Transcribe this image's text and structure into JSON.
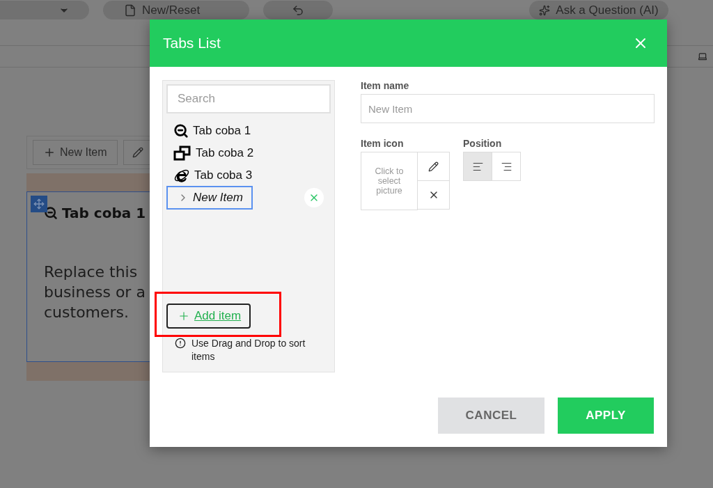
{
  "background": {
    "toolbar": {
      "reset_button": "New/Reset",
      "ask_button": "Ask a Question (AI)"
    },
    "widget": {
      "new_item_button": "New Item",
      "tab_title": "Tab coba 1",
      "text_lines": [
        "Replace this",
        "business or a",
        "customers."
      ]
    }
  },
  "dialog": {
    "title": "Tabs List",
    "search": {
      "placeholder": "Search"
    },
    "items": [
      {
        "label": "Tab coba 1",
        "kind": "zoom",
        "selected": false
      },
      {
        "label": "Tab coba 2",
        "kind": "windows",
        "selected": false
      },
      {
        "label": "Tab coba 3",
        "kind": "browser",
        "selected": false
      },
      {
        "label": "New Item",
        "kind": "plain",
        "selected": true
      }
    ],
    "add_button": "Add item",
    "hint": "Use Drag and Drop to sort items",
    "item_name": {
      "label": "Item name",
      "placeholder": "New Item"
    },
    "item_icon": {
      "label": "Item icon",
      "prompt": "Click to select picture"
    },
    "position": {
      "label": "Position",
      "options": [
        {
          "kind": "left",
          "selected": true
        },
        {
          "kind": "right",
          "selected": false
        }
      ]
    },
    "buttons": [
      {
        "kind": "cancel",
        "label": "CANCEL"
      },
      {
        "kind": "apply",
        "label": "APPLY"
      }
    ]
  }
}
